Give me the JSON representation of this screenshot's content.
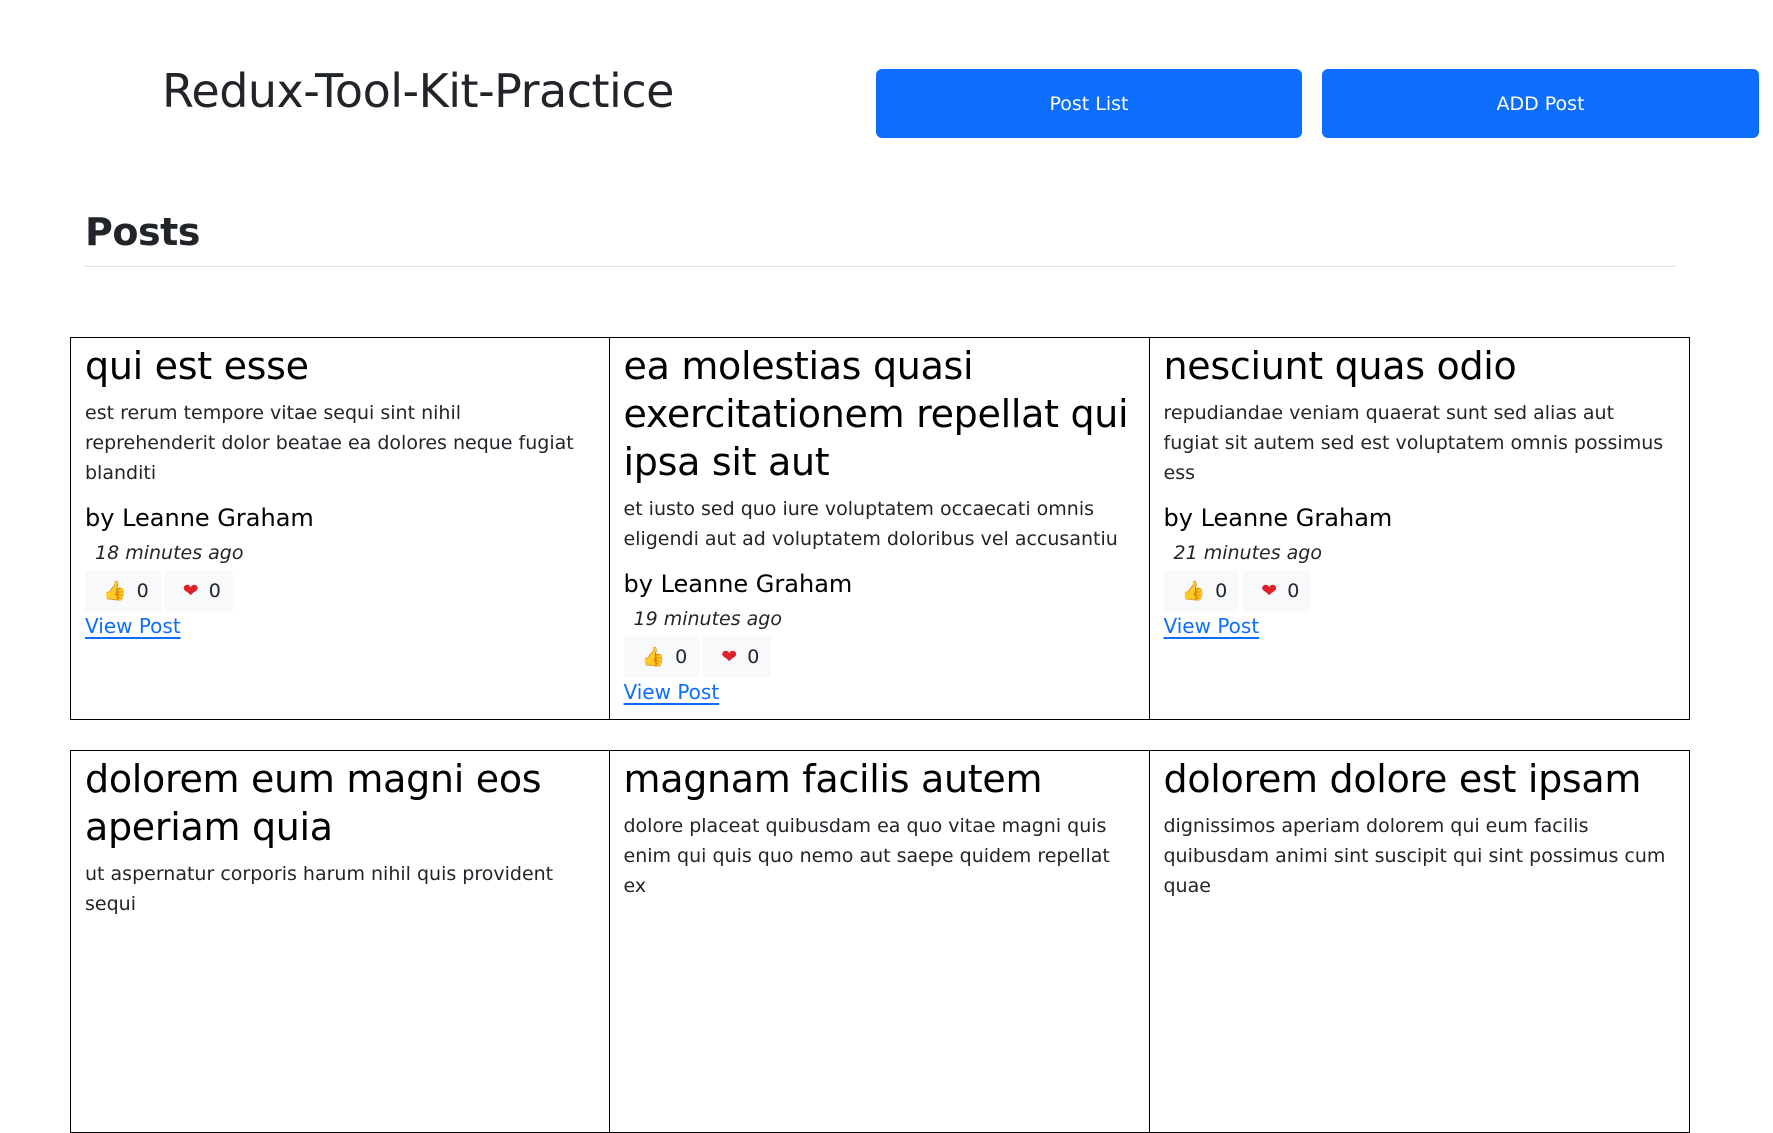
{
  "header": {
    "app_title": "Redux-Tool-Kit-Practice",
    "nav": {
      "post_list_label": "Post List",
      "add_post_label": "ADD Post"
    }
  },
  "main": {
    "section_title": "Posts",
    "posts": [
      {
        "title": "qui est esse",
        "body": "est rerum tempore vitae sequi sint nihil reprehenderit dolor beatae ea dolores neque fugiat blanditi",
        "author": "by Leanne Graham",
        "time": "18 minutes ago",
        "thumbs_up": "0",
        "hearts": "0",
        "link_label": "View Post"
      },
      {
        "title": "ea molestias quasi exercitationem repellat qui ipsa sit aut",
        "body": "et iusto sed quo iure voluptatem occaecati omnis eligendi aut ad voluptatem doloribus vel accusantiu",
        "author": "by Leanne Graham",
        "time": "19 minutes ago",
        "thumbs_up": "0",
        "hearts": "0",
        "link_label": "View Post"
      },
      {
        "title": "nesciunt quas odio",
        "body": "repudiandae veniam quaerat sunt sed alias aut fugiat sit autem sed est voluptatem omnis possimus ess",
        "author": "by Leanne Graham",
        "time": "21 minutes ago",
        "thumbs_up": "0",
        "hearts": "0",
        "link_label": "View Post"
      },
      {
        "title": "dolorem eum magni eos aperiam quia",
        "body": "ut aspernatur corporis harum nihil quis provident sequi"
      },
      {
        "title": "magnam facilis autem",
        "body": "dolore placeat quibusdam ea quo vitae magni quis enim qui quis quo nemo aut saepe quidem repellat ex"
      },
      {
        "title": "dolorem dolore est ipsam",
        "body": "dignissimos aperiam dolorem qui eum facilis quibusdam animi sint suscipit qui sint possimus cum quae"
      }
    ]
  },
  "icons": {
    "thumbs_up": "thumbs-up-icon",
    "heart": "heart-icon"
  },
  "colors": {
    "primary": "#0d6efd",
    "heart": "#e0202a",
    "thumb": "#f4b400"
  }
}
